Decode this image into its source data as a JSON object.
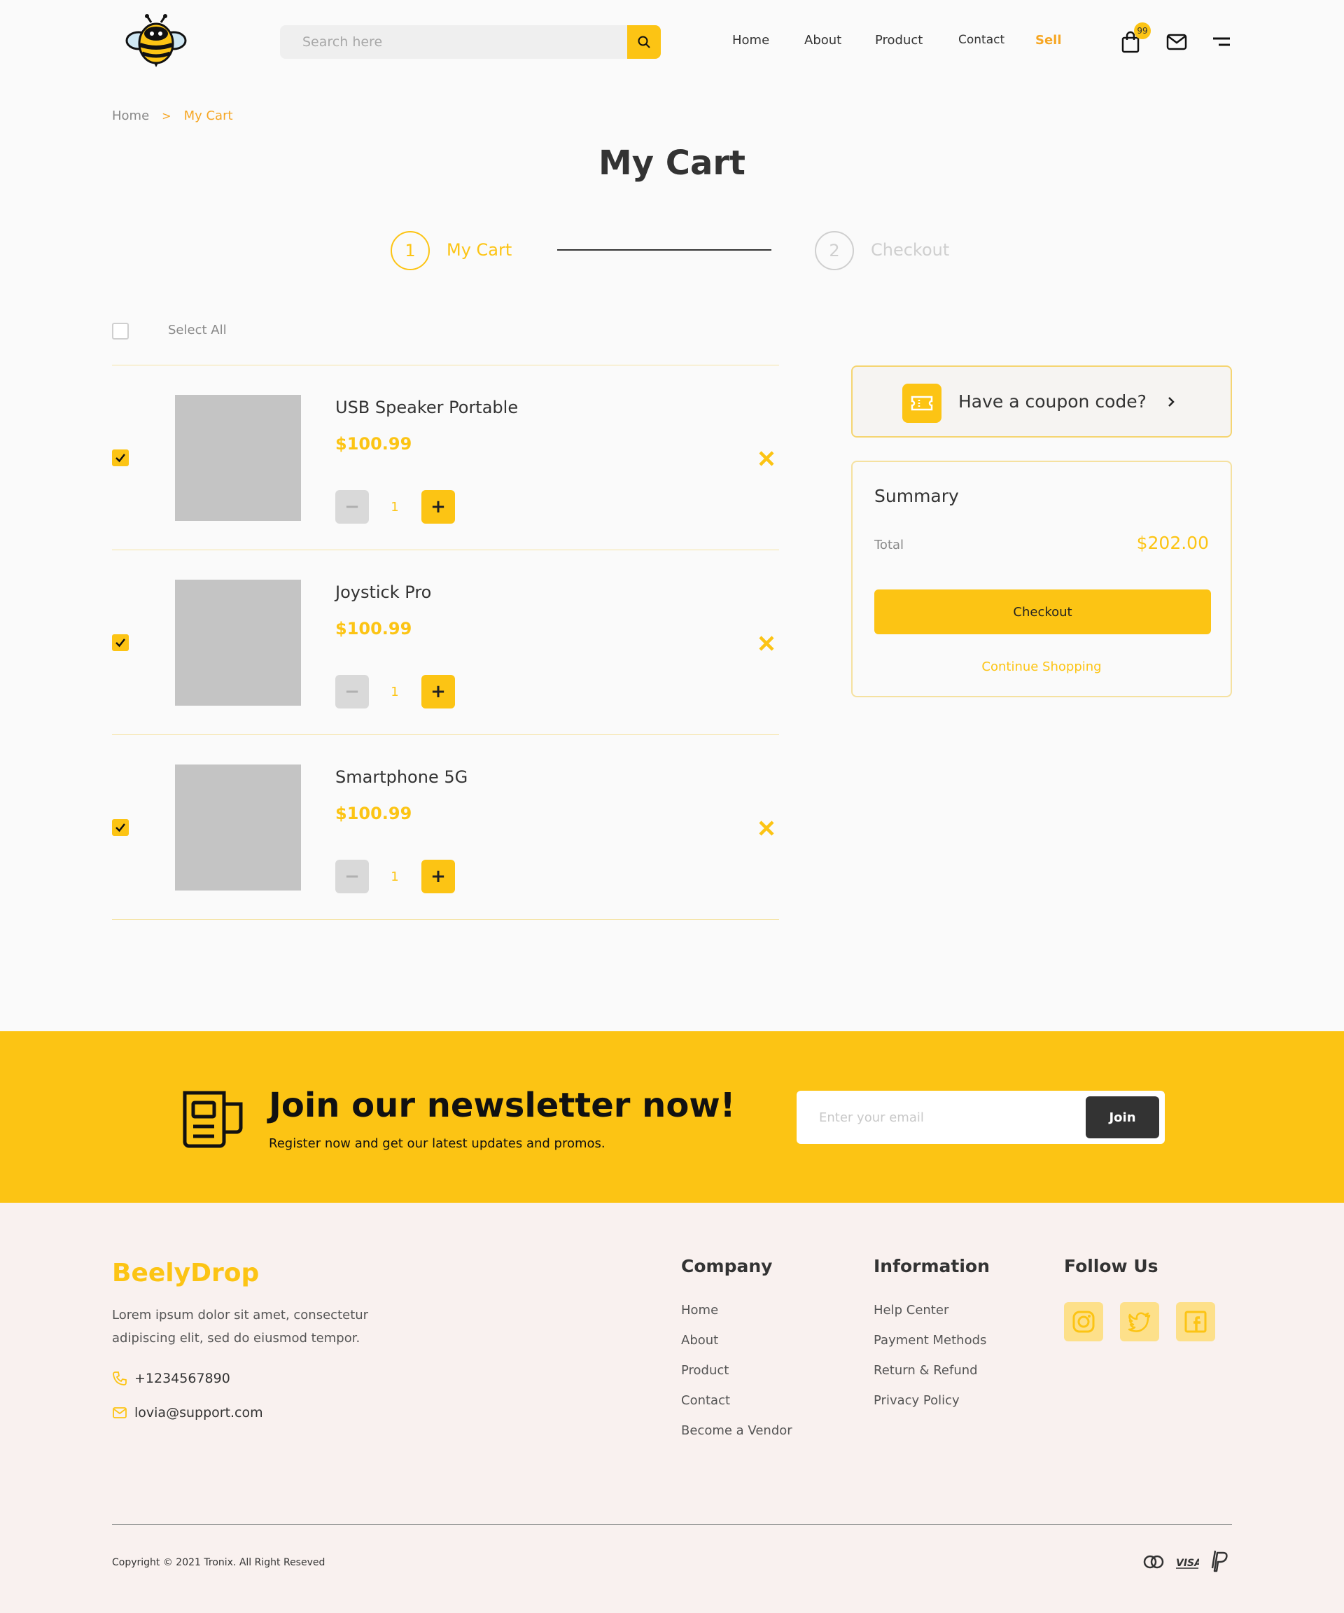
{
  "header": {
    "search_placeholder": "Search here",
    "nav": [
      "Home",
      "About",
      "Product",
      "Contact",
      "Sell"
    ],
    "cart_badge": "99"
  },
  "breadcrumb": {
    "home": "Home",
    "separator": ">",
    "current": "My Cart"
  },
  "page_title": "My Cart",
  "stepper": {
    "steps": [
      {
        "number": "1",
        "label": "My Cart",
        "active": true
      },
      {
        "number": "2",
        "label": "Checkout",
        "active": false
      }
    ]
  },
  "cart": {
    "select_all_label": "Select All",
    "select_all_checked": false,
    "items": [
      {
        "name": "USB Speaker Portable",
        "price": "$100.99",
        "qty": "1",
        "checked": true
      },
      {
        "name": "Joystick Pro",
        "price": "$100.99",
        "qty": "1",
        "checked": true
      },
      {
        "name": "Smartphone 5G",
        "price": "$100.99",
        "qty": "1",
        "checked": true
      }
    ],
    "minus_symbol": "−",
    "plus_symbol": "+"
  },
  "coupon": {
    "label": "Have a coupon code?"
  },
  "summary": {
    "title": "Summary",
    "total_label": "Total",
    "total_value": "$202.00",
    "checkout_label": "Checkout",
    "continue_label": "Continue Shopping"
  },
  "newsletter": {
    "title": "Join our newsletter now!",
    "subtitle": "Register now and get our latest updates and promos.",
    "email_placeholder": "Enter your email",
    "join_label": "Join"
  },
  "footer": {
    "brand": "BeelyDrop",
    "description": "Lorem ipsum dolor sit amet, consectetur adipiscing elit, sed do eiusmod tempor.",
    "phone": "+1234567890",
    "email": "lovia@support.com",
    "company_heading": "Company",
    "company_links": [
      "Home",
      "About",
      "Product",
      "Contact",
      "Become a Vendor"
    ],
    "information_heading": "Information",
    "information_links": [
      "Help Center",
      "Payment Methods",
      "Return & Refund",
      "Privacy Policy"
    ],
    "follow_heading": "Follow Us",
    "social_icons": [
      "instagram-icon",
      "twitter-icon",
      "facebook-icon"
    ],
    "copyright": "Copyright © 2021 Tronix. All Right Reseved",
    "payment_icons": [
      "mastercard-icon",
      "visa-icon",
      "paypal-icon"
    ]
  },
  "colors": {
    "accent": "#fcc414",
    "accent_orange": "#f6a623",
    "dark": "#333333",
    "footer_bg": "#f9f1ef",
    "placeholder_gray": "#c4c4c4"
  }
}
